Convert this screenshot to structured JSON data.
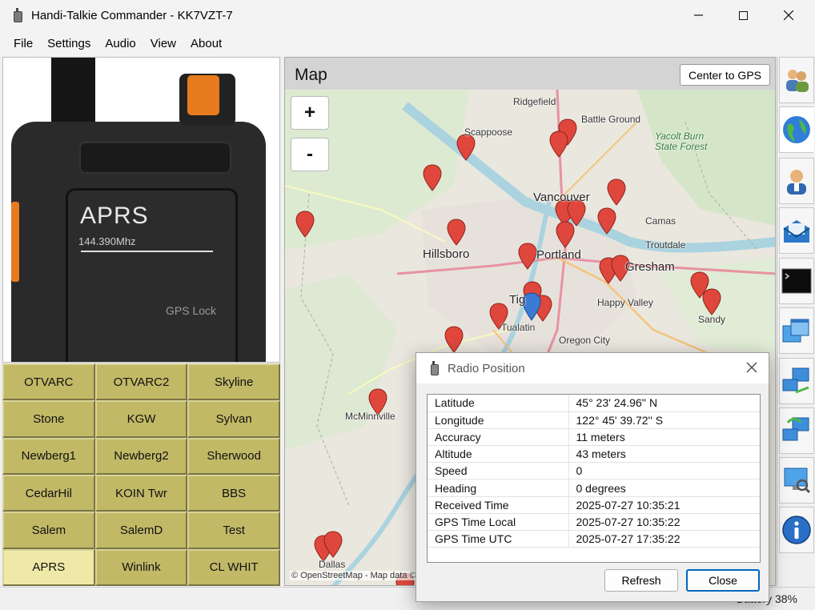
{
  "window": {
    "title": "Handi-Talkie Commander - KK7VZT-7"
  },
  "menu": [
    "File",
    "Settings",
    "Audio",
    "View",
    "About"
  ],
  "radio": {
    "mode": "APRS",
    "frequency": "144.390Mhz",
    "status": "GPS Lock"
  },
  "channels": [
    "OTVARC",
    "OTVARC2",
    "Skyline",
    "Stone",
    "KGW",
    "Sylvan",
    "Newberg1",
    "Newberg2",
    "Sherwood",
    "CedarHil",
    "KOIN Twr",
    "BBS",
    "Salem",
    "SalemD",
    "Test",
    "APRS",
    "Winlink",
    "CL WHIT"
  ],
  "active_channel": "APRS",
  "map": {
    "title": "Map",
    "center_gps_label": "Center to GPS",
    "zoom_in": "+",
    "zoom_out": "-",
    "cities": {
      "ridgefield": "Ridgefield",
      "battle_ground": "Battle Ground",
      "scappoose": "Scappoose",
      "yacolt": "Yacolt Burn\nState Forest",
      "vancouver": "Vancouver",
      "camas": "Camas",
      "troutdale": "Troutdale",
      "hillsboro": "Hillsboro",
      "portland": "Portland",
      "gresham": "Gresham",
      "happy_valley": "Happy Valley",
      "tigard": "Tig",
      "tualatin": "Tualatin",
      "oregon_city": "Oregon City",
      "sandy": "Sandy",
      "mcminnville": "McMinnville",
      "dallas": "Dallas"
    },
    "attribution": "© OpenStreetMap - Map data ©"
  },
  "toolbar": [
    "users-icon",
    "globe-icon",
    "contact-icon",
    "mail-icon",
    "terminal-icon",
    "windows-icon",
    "network-icon",
    "sync-icon",
    "monitor-search-icon",
    "info-icon"
  ],
  "status": {
    "battery": "Battery 38%"
  },
  "dialog": {
    "title": "Radio Position",
    "rows": [
      {
        "label": "Latitude",
        "value": "45° 23' 24.96'' N"
      },
      {
        "label": "Longitude",
        "value": "122° 45' 39.72'' S"
      },
      {
        "label": "Accuracy",
        "value": "11 meters"
      },
      {
        "label": "Altitude",
        "value": "43 meters"
      },
      {
        "label": "Speed",
        "value": "0"
      },
      {
        "label": "Heading",
        "value": "0 degrees"
      },
      {
        "label": "Received Time",
        "value": "2025-07-27 10:35:21"
      },
      {
        "label": "GPS Time Local",
        "value": "2025-07-27 10:35:22"
      },
      {
        "label": "GPS Time UTC",
        "value": "2025-07-27 17:35:22"
      }
    ],
    "refresh_label": "Refresh",
    "close_label": "Close"
  },
  "colors": {
    "channel_bg": "#c2b967",
    "channel_active": "#efe9a8",
    "marker_red": "#e0473c",
    "marker_blue": "#3a7bd5"
  }
}
